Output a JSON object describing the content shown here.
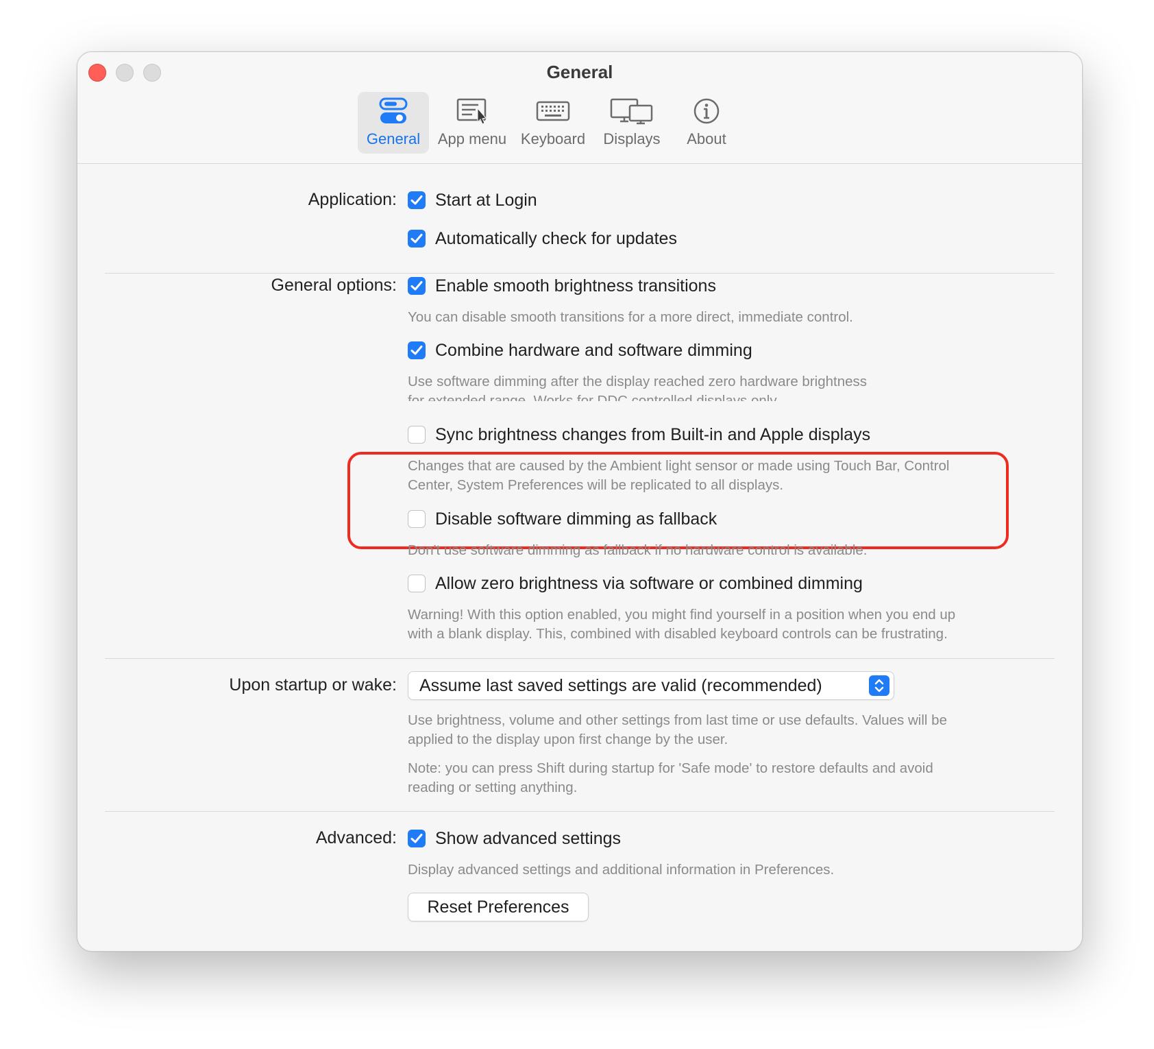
{
  "window": {
    "title": "General"
  },
  "toolbar": {
    "tabs": [
      {
        "label": "General",
        "icon": "toggle-switches-icon",
        "active": true
      },
      {
        "label": "App menu",
        "icon": "app-menu-icon",
        "active": false
      },
      {
        "label": "Keyboard",
        "icon": "keyboard-icon",
        "active": false
      },
      {
        "label": "Displays",
        "icon": "displays-icon",
        "active": false
      },
      {
        "label": "About",
        "icon": "info-icon",
        "active": false
      }
    ]
  },
  "application": {
    "label": "Application:",
    "start_at_login": {
      "label": "Start at Login",
      "checked": true
    },
    "check_updates": {
      "label": "Automatically check for updates",
      "checked": true
    }
  },
  "general_options": {
    "label": "General options:",
    "smooth": {
      "label": "Enable smooth brightness transitions",
      "checked": true,
      "help": "You can disable smooth transitions for a more direct, immediate control."
    },
    "combine": {
      "label": "Combine hardware and software dimming",
      "checked": true,
      "help_1": "Use software dimming after the display reached zero hardware brightness",
      "help_2": "for extended range. Works for DDC controlled displays only."
    },
    "sync": {
      "label": "Sync brightness changes from Built-in and Apple displays",
      "checked": false,
      "help_1": "Changes that are caused by the Ambient light sensor or made using Touch Bar, Control",
      "help_2": "Center, System Preferences will be replicated to all displays."
    },
    "disable_fallback": {
      "label": "Disable software dimming as fallback",
      "checked": false,
      "help": "Don't use software dimming as fallback if no hardware control is available."
    },
    "zero_brightness": {
      "label": "Allow zero brightness via software or combined dimming",
      "checked": false,
      "help_1": "Warning! With this option enabled, you might find yourself in a position when you end up",
      "help_2": "with a blank display. This, combined with disabled keyboard controls can be frustrating."
    }
  },
  "startup": {
    "label": "Upon startup or wake:",
    "selected": "Assume last saved settings are valid (recommended)",
    "help_1": "Use brightness, volume and other settings from last time or use defaults. Values will be",
    "help_2": "applied to the display upon first change by the user.",
    "note_1": "Note: you can press Shift during startup for 'Safe mode' to restore defaults and avoid",
    "note_2": "reading or setting anything."
  },
  "advanced": {
    "label": "Advanced:",
    "show": {
      "label": "Show advanced settings",
      "checked": true,
      "help": "Display advanced settings and additional information in Preferences."
    },
    "reset_button": "Reset Preferences"
  },
  "colors": {
    "accent": "#1f7bf6",
    "highlight": "#ee2b20",
    "close": "#ff5f57"
  }
}
